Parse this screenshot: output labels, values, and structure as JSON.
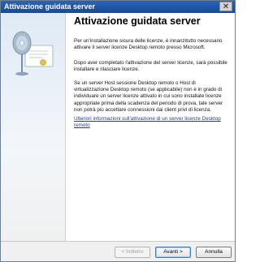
{
  "window": {
    "title": "Attivazione guidata server",
    "close_glyph": "✕"
  },
  "sidebar": {
    "illustration": "certificate-disc-icon"
  },
  "main": {
    "heading": "Attivazione guidata server",
    "paragraphs": [
      "Per un'installazione sicura delle licenze, è innanzitutto necessario attivare il server licenze Desktop remoto presso Microsoft.",
      "Dopo aver completato l'attivazione del server licenze, sarà possibile installare e rilasciare licenze.",
      "Se un server Host sessione Desktop remoto o Host di virtualizzazione Desktop remoto (se applicabile) non è in grado di individuare un server licenze attivato in cui sono installate licenze appropriate prima della scadenza del periodo di prova, tale server non potrà più accettare connessioni dai client privi di licenza."
    ],
    "more_info_link": "Ulteriori informazioni sull'attivazione di un server licenze Desktop remoto"
  },
  "buttons": {
    "back": "< Indietro",
    "next": "Avanti >",
    "cancel": "Annulla"
  },
  "colors": {
    "titlebar": "#1f56a8",
    "link": "#1a3ea8"
  }
}
